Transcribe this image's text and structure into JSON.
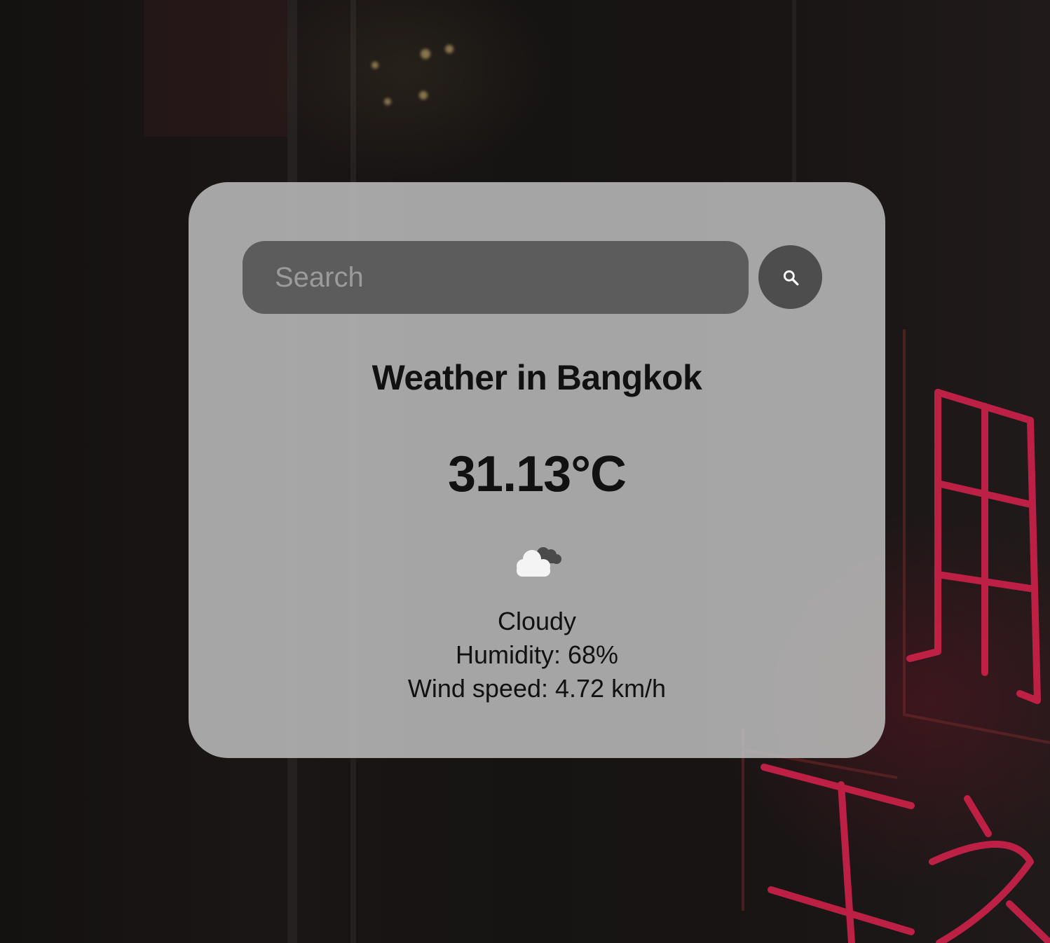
{
  "search": {
    "placeholder": "Search",
    "value": ""
  },
  "weather": {
    "title": "Weather in Bangkok",
    "temperature": "31.13°C",
    "icon": "cloudy-icon",
    "description": "Cloudy",
    "humidity": "Humidity: 68%",
    "wind": "Wind speed: 4.72 km/h"
  },
  "colors": {
    "card": "#bebebe",
    "search_field": "#5c5c5c",
    "search_button": "#4d4d4d",
    "text": "#111111",
    "neon_accent": "#d8224c"
  },
  "icons": {
    "search_button": "search-icon",
    "background": "neon-sign-background"
  }
}
